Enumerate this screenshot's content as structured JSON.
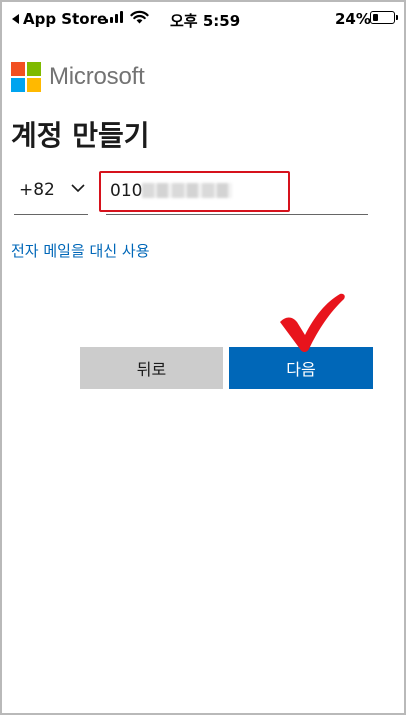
{
  "status_bar": {
    "back_app": "App Store",
    "time": "오후 5:59",
    "battery": "24%"
  },
  "logo": {
    "text": "Microsoft",
    "colors": [
      "#f25022",
      "#7fba00",
      "#00a4ef",
      "#ffb900"
    ]
  },
  "page": {
    "title": "계정 만들기"
  },
  "phone": {
    "country_code": "+82",
    "value": "010"
  },
  "alt_link": "전자 메일을 대신 사용",
  "buttons": {
    "back": "뒤로",
    "next": "다음"
  },
  "colors": {
    "accent": "#0067b8",
    "highlight": "#d6121c",
    "checkmark": "#e8141c"
  }
}
